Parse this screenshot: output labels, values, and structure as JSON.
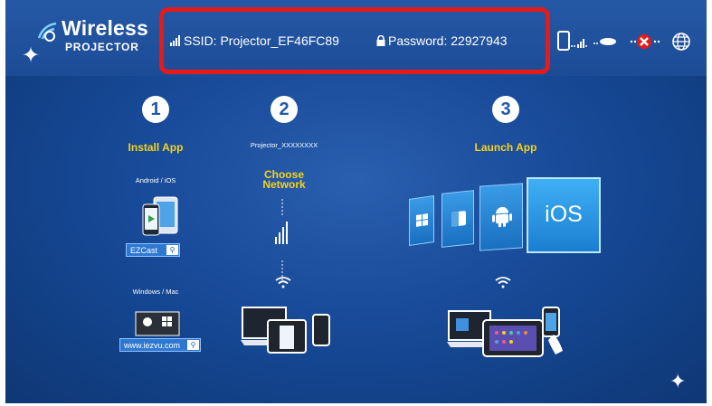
{
  "brand": {
    "title": "Wireless",
    "subtitle": "PROJECTOR"
  },
  "network": {
    "ssid_label": "SSID: Projector_EF46FC89",
    "password_label": "Password: 22927943"
  },
  "steps": [
    {
      "number": "1",
      "title": "Install App"
    },
    {
      "number": "2",
      "title": "Choose Network"
    },
    {
      "number": "3",
      "title": "Launch App"
    }
  ],
  "step1": {
    "mobile_label": "Android / iOS",
    "desktop_label": "Windows / Mac",
    "app_search": "EZCast",
    "site_search": "www.iezvu.com"
  },
  "step2": {
    "network_name": "Projector_XXXXXXXX"
  },
  "step3": {
    "tile_label": "iOS"
  },
  "colors": {
    "background": "#174a98",
    "accent_yellow": "#f7d21a",
    "highlight_red": "#e31b1b"
  }
}
